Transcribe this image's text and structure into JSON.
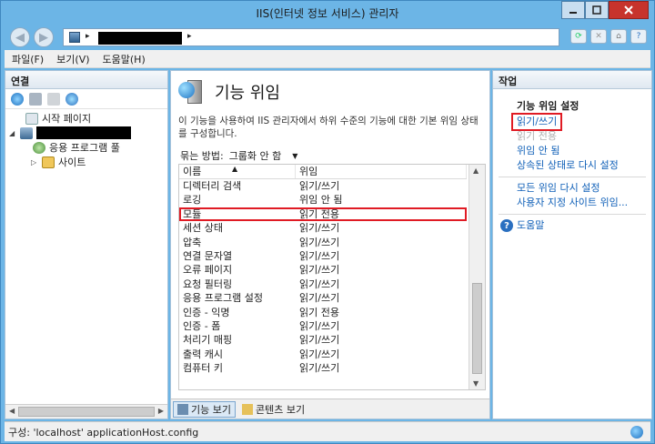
{
  "window": {
    "title": "IIS(인터넷 정보 서비스) 관리자"
  },
  "address": {
    "sep": "▸"
  },
  "menu": [
    "파일(F)",
    "보기(V)",
    "도움말(H)"
  ],
  "connections": {
    "header": "연결",
    "tree": [
      {
        "label": "시작 페이지"
      },
      {
        "label": ""
      },
      {
        "label": "응용 프로그램 풀"
      },
      {
        "label": "사이트"
      }
    ]
  },
  "main": {
    "title": "기능 위임",
    "description": "이 기능을 사용하여 IIS 관리자에서 하위 수준의 기능에 대한 기본 위임 상태를 구성합니다.",
    "group_by_label": "묶는 방법:",
    "group_by_value": "그룹화 안 함",
    "columns": [
      "이름",
      "위임"
    ],
    "rows": [
      {
        "name": "디렉터리 검색",
        "delegation": "읽기/쓰기"
      },
      {
        "name": "로깅",
        "delegation": "위임 안 됨"
      },
      {
        "name": "모듈",
        "delegation": "읽기 전용",
        "highlight": true
      },
      {
        "name": "세션 상태",
        "delegation": "읽기/쓰기"
      },
      {
        "name": "압축",
        "delegation": "읽기/쓰기"
      },
      {
        "name": "연결 문자열",
        "delegation": "읽기/쓰기"
      },
      {
        "name": "오류 페이지",
        "delegation": "읽기/쓰기"
      },
      {
        "name": "요청 필터링",
        "delegation": "읽기/쓰기"
      },
      {
        "name": "응용 프로그램 설정",
        "delegation": "읽기/쓰기"
      },
      {
        "name": "인증 - 익명",
        "delegation": "읽기 전용"
      },
      {
        "name": "인증 - 폼",
        "delegation": "읽기/쓰기"
      },
      {
        "name": "처리기 매핑",
        "delegation": "읽기/쓰기"
      },
      {
        "name": "출력 캐시",
        "delegation": "읽기/쓰기"
      },
      {
        "name": "컴퓨터 키",
        "delegation": "읽기/쓰기"
      },
      {
        "name": "",
        "delegation": ""
      }
    ],
    "view_features": "기능 보기",
    "view_content": "콘텐츠 보기"
  },
  "actions": {
    "header": "작업",
    "section_title": "기능 위임 설정",
    "read_write": "읽기/쓰기",
    "read_only": "읽기 전용",
    "not_delegated": "위임 안 됨",
    "reset_inherited": "상속된 상태로 다시 설정",
    "reset_all": "모든 위임 다시 설정",
    "custom_site": "사용자 지정 사이트 위임...",
    "help": "도움말"
  },
  "status": {
    "text": "구성: 'localhost' applicationHost.config"
  }
}
